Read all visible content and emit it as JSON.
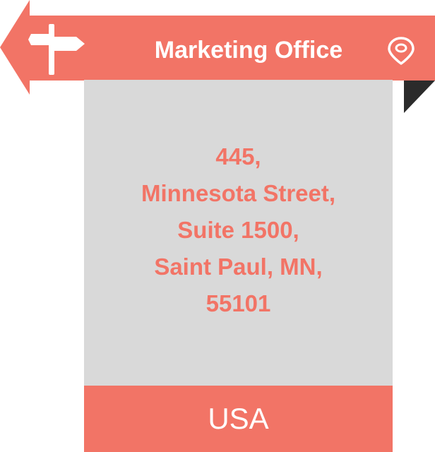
{
  "banner": {
    "title": "Marketing Office",
    "icon_left": "signpost-icon",
    "icon_right": "location-pin-icon"
  },
  "address": {
    "lines": [
      "445,",
      "Minnesota Street,",
      "Suite 1500,",
      "Saint Paul, MN,",
      "55101"
    ]
  },
  "country": {
    "label": "USA"
  },
  "colors": {
    "accent": "#f27466",
    "card": "#d9d9d9",
    "fold": "#2b2b2b",
    "text_on_accent": "#ffffff"
  }
}
